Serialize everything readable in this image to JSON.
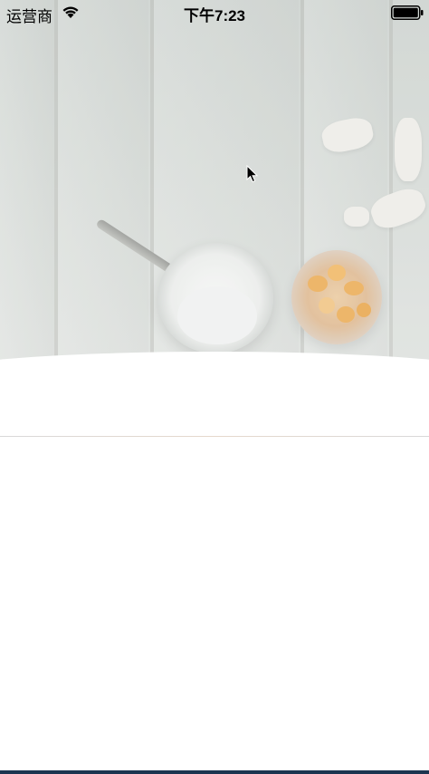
{
  "status_bar": {
    "carrier": "运营商",
    "time": "下午7:23",
    "wifi_icon": "wifi-icon",
    "battery_icon": "battery-icon"
  },
  "hero": {
    "image": "breakfast-table-photo",
    "description_icon": "photo"
  },
  "colors": {
    "sheet": "#ffffff",
    "status_text": "#000000",
    "bottom_edge": "#1c3550"
  },
  "cursor": {
    "icon": "mouse-pointer-icon"
  }
}
